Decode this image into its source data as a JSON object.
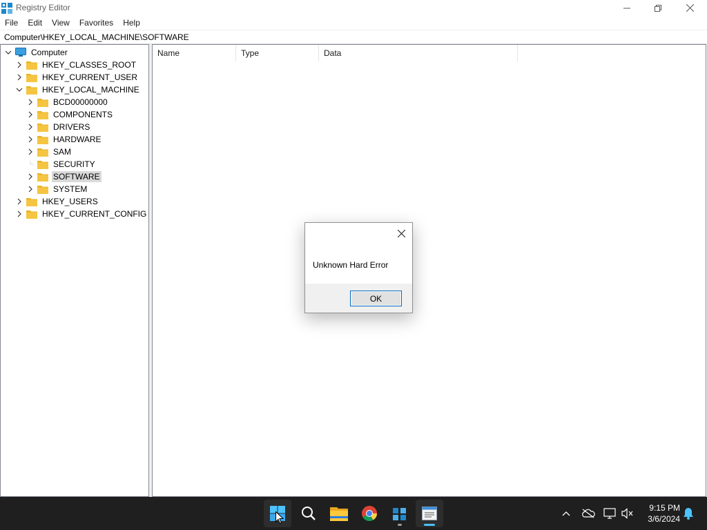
{
  "window": {
    "title": "Registry Editor",
    "icon": "registry-editor-icon"
  },
  "menu": [
    "File",
    "Edit",
    "View",
    "Favorites",
    "Help"
  ],
  "address": "Computer\\HKEY_LOCAL_MACHINE\\SOFTWARE",
  "tree": {
    "root": "Computer",
    "hives": [
      "HKEY_CLASSES_ROOT",
      "HKEY_CURRENT_USER",
      "HKEY_LOCAL_MACHINE",
      "HKEY_USERS",
      "HKEY_CURRENT_CONFIG"
    ],
    "hklm_children": [
      "BCD00000000",
      "COMPONENTS",
      "DRIVERS",
      "HARDWARE",
      "SAM",
      "SECURITY",
      "SOFTWARE",
      "SYSTEM"
    ],
    "selected": "SOFTWARE"
  },
  "list": {
    "columns": [
      "Name",
      "Type",
      "Data"
    ]
  },
  "dialog": {
    "message": "Unknown Hard Error",
    "ok_label": "OK"
  },
  "taskbar": {
    "apps": [
      "start-icon",
      "search-icon",
      "file-explorer-icon",
      "chrome-icon",
      "registry-icon",
      "notepad-icon"
    ],
    "time": "9:15 PM",
    "date": "3/6/2024"
  },
  "colors": {
    "accent": "#0067c0",
    "taskbar": "#1f1f1f",
    "folder": "#f5c542",
    "selected_bg": "#d9d9d9"
  }
}
